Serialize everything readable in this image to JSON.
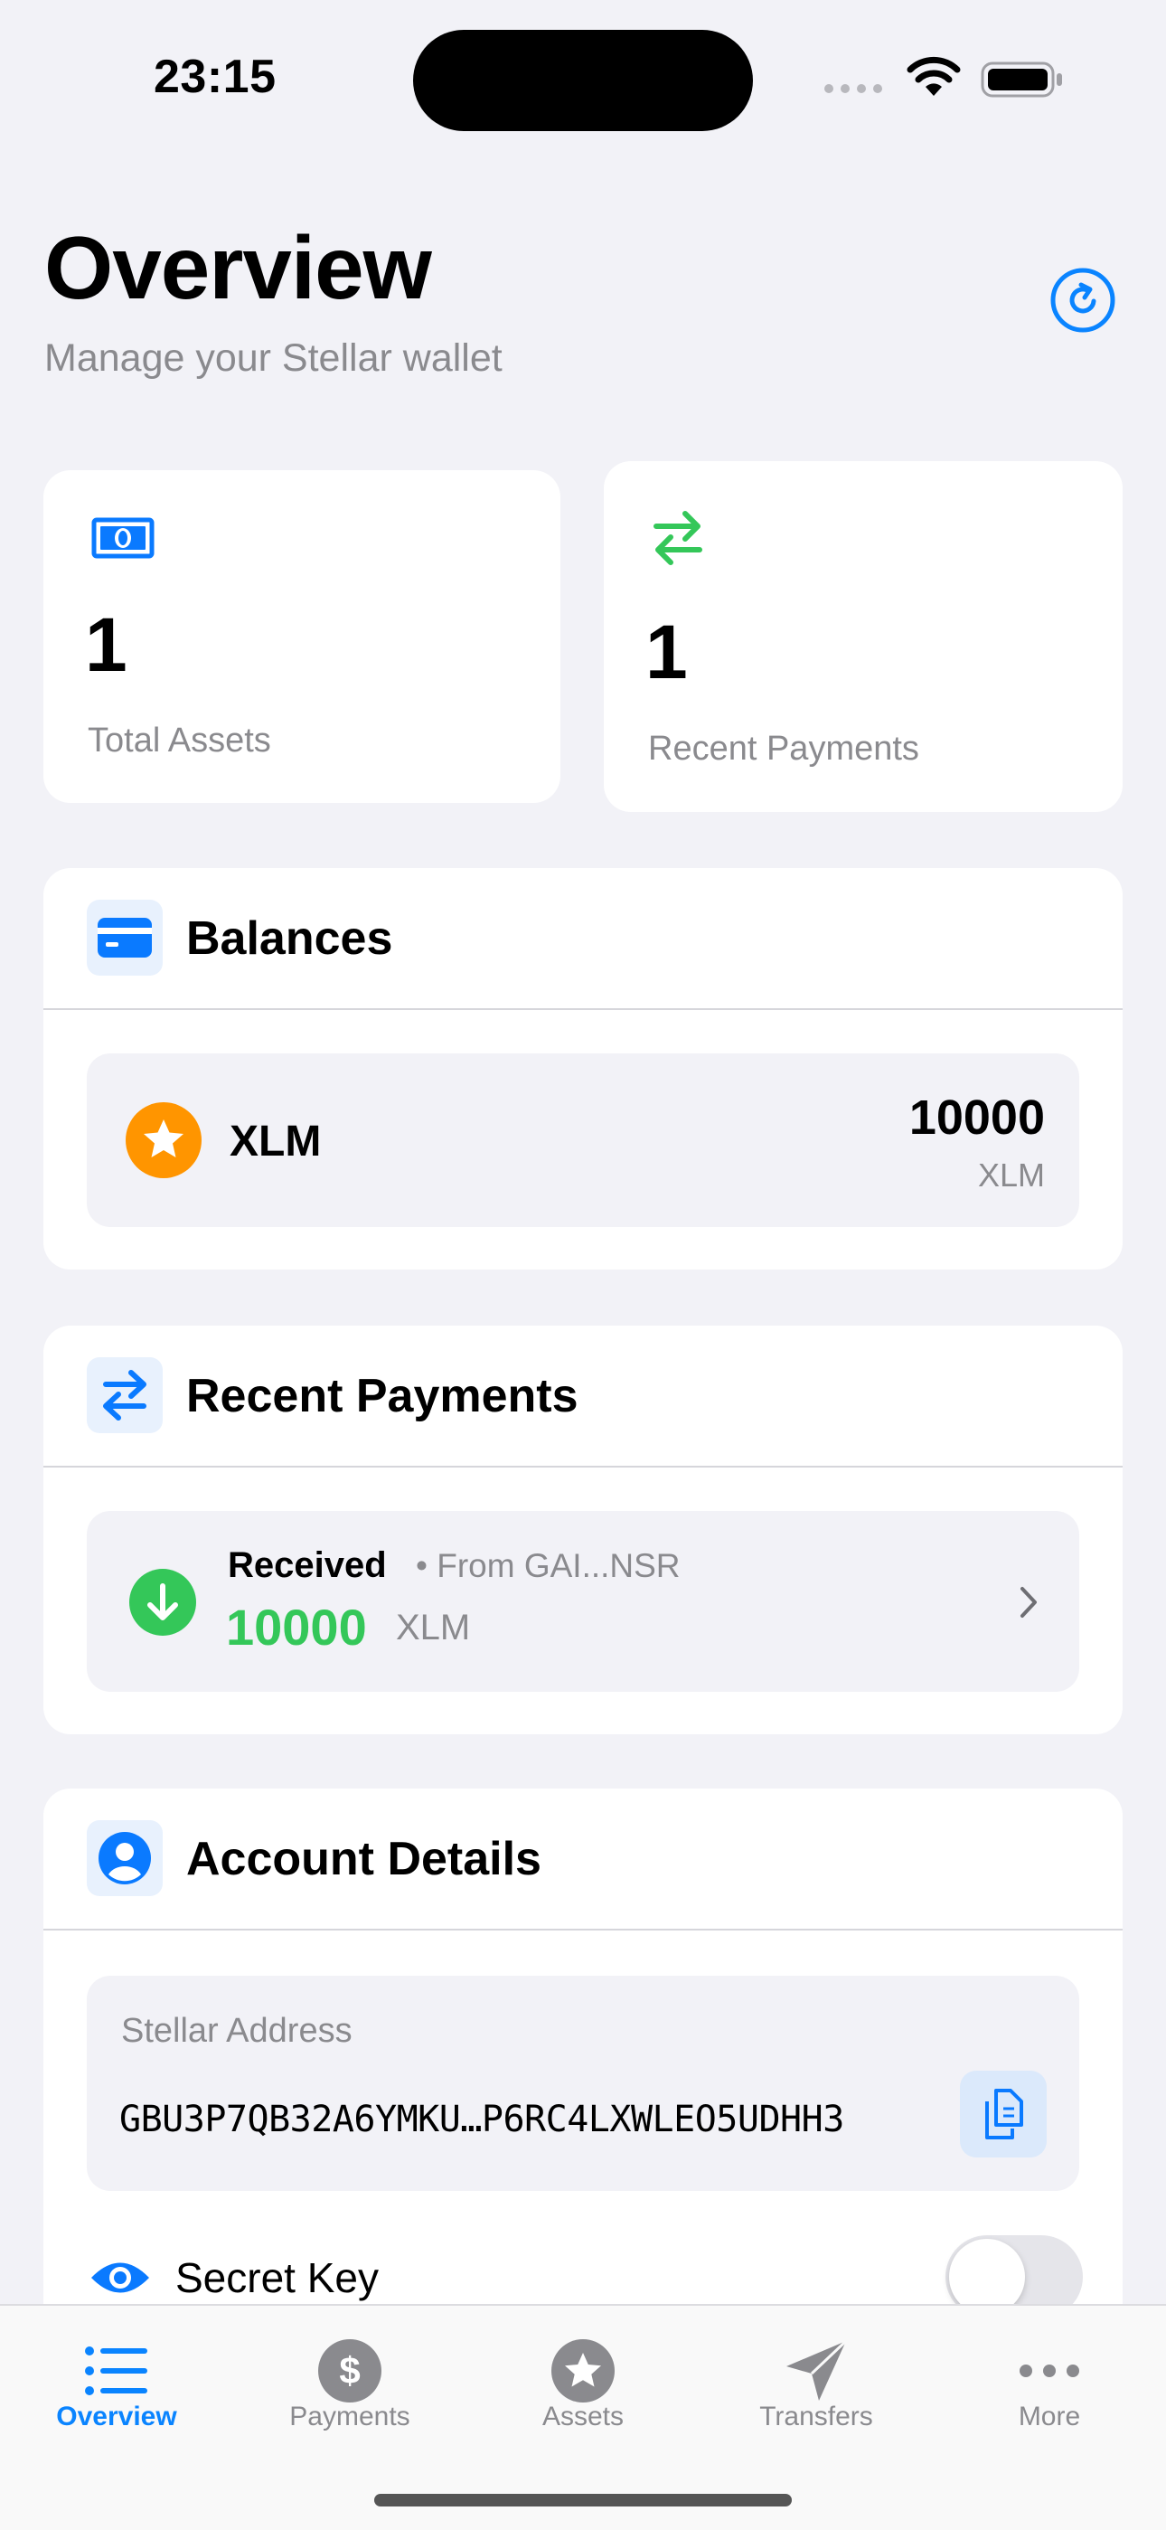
{
  "status_bar": {
    "time": "23:15"
  },
  "header": {
    "title": "Overview",
    "subtitle": "Manage your Stellar wallet",
    "refresh_icon": "refresh-icon"
  },
  "stats": [
    {
      "icon": "banknote-icon",
      "value": "1",
      "label": "Total Assets",
      "color": "#0a7aff"
    },
    {
      "icon": "arrows-swap-icon",
      "value": "1",
      "label": "Recent Payments",
      "color": "#34c759"
    }
  ],
  "balances": {
    "title": "Balances",
    "items": [
      {
        "asset": "XLM",
        "amount": "10000",
        "unit": "XLM",
        "icon": "star-icon",
        "icon_color": "#ff9500"
      }
    ]
  },
  "recent_payments": {
    "title": "Recent Payments",
    "items": [
      {
        "type": "Received",
        "from": "• From GAI...NSR",
        "amount": "10000",
        "unit": "XLM",
        "amount_color": "#34c759"
      }
    ]
  },
  "account_details": {
    "title": "Account Details",
    "address_label": "Stellar Address",
    "address": "GBU3P7QB32A6YMKU…P6RC4LXWLEO5UDHH3",
    "secret_label": "Secret Key",
    "secret_toggle_on": false
  },
  "tabs": [
    {
      "label": "Overview",
      "icon": "list-icon",
      "active": true
    },
    {
      "label": "Payments",
      "icon": "dollar-circle-icon",
      "active": false
    },
    {
      "label": "Assets",
      "icon": "star-circle-icon",
      "active": false
    },
    {
      "label": "Transfers",
      "icon": "paperplane-icon",
      "active": false
    },
    {
      "label": "More",
      "icon": "more-icon",
      "active": false
    }
  ],
  "colors": {
    "accent": "#0a84ff",
    "background": "#f2f2f7",
    "success": "#34c759",
    "xlm": "#ff9500"
  }
}
